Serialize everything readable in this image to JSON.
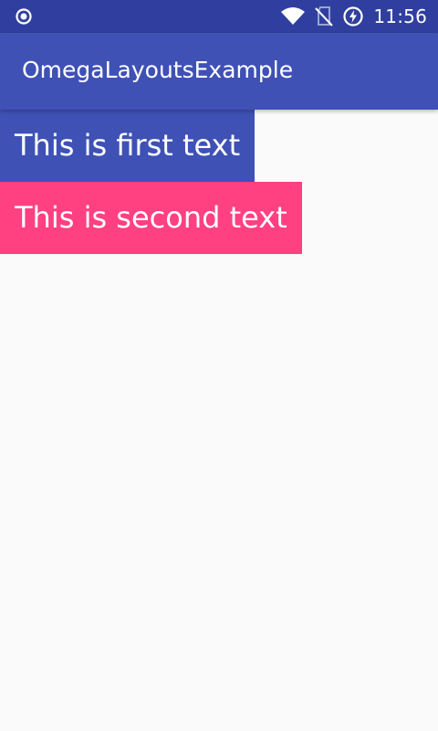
{
  "status_bar": {
    "time": "11:56",
    "icons": [
      "record-icon",
      "wifi-icon",
      "no-sim-icon",
      "battery-charging-icon"
    ]
  },
  "app_bar": {
    "title": "OmegaLayoutsExample"
  },
  "content": {
    "first_text": "This is first text",
    "second_text": "This is second text"
  },
  "colors": {
    "status_bar": "#303f9f",
    "primary": "#3f51b5",
    "accent": "#ff4081",
    "background": "#fafafa"
  }
}
